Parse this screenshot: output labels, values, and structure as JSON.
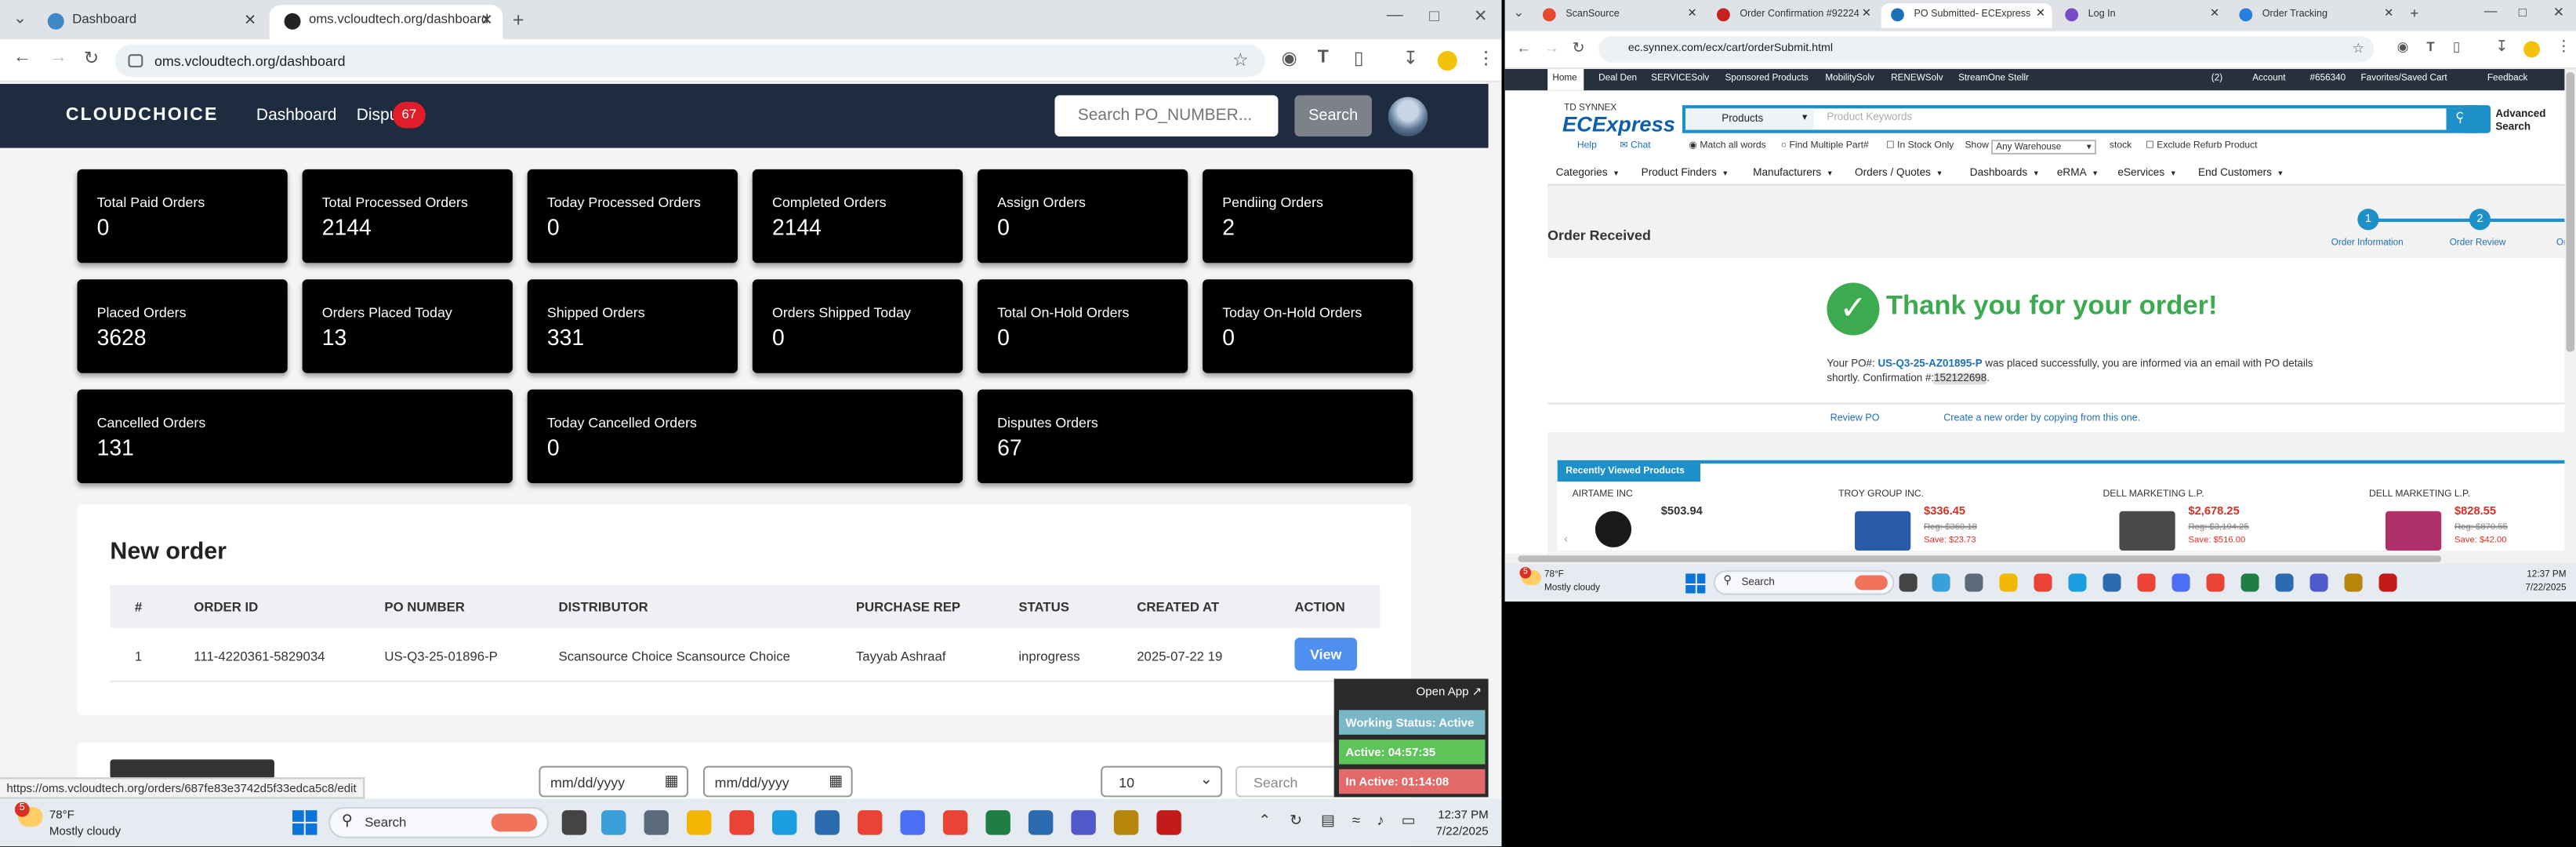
{
  "left_browser": {
    "tabs": [
      {
        "title": "Dashboard"
      },
      {
        "title": "oms.vcloudtech.org/dashboard"
      }
    ],
    "url": "oms.vcloudtech.org/dashboard"
  },
  "oms": {
    "logo": "CLOUDCHOICE",
    "nav": {
      "dashboard": "Dashboard",
      "disputes": "Dispu",
      "disputes_badge": "67"
    },
    "search": {
      "placeholder": "Search PO_NUMBER...",
      "button": "Search"
    },
    "stats": [
      {
        "label": "Total Paid Orders",
        "value": "0"
      },
      {
        "label": "Total Processed Orders",
        "value": "2144"
      },
      {
        "label": "Today Processed Orders",
        "value": "0"
      },
      {
        "label": "Completed Orders",
        "value": "2144"
      },
      {
        "label": "Assign Orders",
        "value": "0"
      },
      {
        "label": "Pendiing Orders",
        "value": "2"
      },
      {
        "label": "Placed Orders",
        "value": "3628"
      },
      {
        "label": "Orders Placed Today",
        "value": "13"
      },
      {
        "label": "Shipped Orders",
        "value": "331"
      },
      {
        "label": "Orders Shipped Today",
        "value": "0"
      },
      {
        "label": "Total On-Hold Orders",
        "value": "0"
      },
      {
        "label": "Today On-Hold Orders",
        "value": "0"
      },
      {
        "label": "Cancelled Orders",
        "value": "131"
      },
      {
        "label": "Today Cancelled Orders",
        "value": "0"
      },
      {
        "label": "Disputes Orders",
        "value": "67"
      }
    ],
    "new_order": {
      "title": "New order",
      "columns": [
        "#",
        "ORDER ID",
        "PO NUMBER",
        "DISTRIBUTOR",
        "PURCHASE REP",
        "STATUS",
        "CREATED AT",
        "ACTION"
      ],
      "rows": [
        {
          "num": "1",
          "order_id": "111-4220361-5829034",
          "po": "US-Q3-25-01896-P",
          "distributor": "Scansource Choice Scansource Choice",
          "rep": "Tayyab Ashraaf",
          "status": "inprogress",
          "created": "2025-07-22 19",
          "action": "View"
        }
      ]
    },
    "bottom": {
      "date1": "mm/dd/yyyy",
      "date2": "mm/dd/yyyy",
      "page_size": "10",
      "search": "Search"
    },
    "status_link": "https://oms.vcloudtech.org/orders/687fe83e3742d5f33edca5c8/edit",
    "work_widget": {
      "open_app": "Open App ↗",
      "status": "Working Status: Active",
      "active": "Active: 04:57:35",
      "inactive": "In Active: 01:14:08"
    }
  },
  "left_taskbar": {
    "weather_temp": "78°F",
    "weather_desc": "Mostly cloudy",
    "weather_badge": "5",
    "search": "Search",
    "time": "12:37 PM",
    "date": "7/22/2025"
  },
  "right_browser": {
    "tabs": [
      {
        "title": "ScanSource"
      },
      {
        "title": "Order Confirmation #92224"
      },
      {
        "title": "PO Submitted- ECExpress"
      },
      {
        "title": "Log In"
      },
      {
        "title": "Order Tracking"
      }
    ],
    "url": "ec.synnex.com/ecx/cart/orderSubmit.html",
    "top_nav": [
      "Home",
      "Deal Den",
      "SERVICESolv",
      "Sponsored Products",
      "MobilitySolv",
      "RENEWSolv",
      "StreamOne Stellr"
    ],
    "top_right": {
      "msgs": "(2)",
      "account": "Account",
      "acct_no": "#656340",
      "favorites": "Favorites/Saved Cart",
      "feedback": "Feedback"
    },
    "brand_small": "TD SYNNEX",
    "brand": "ECExpress",
    "search_select": "Products",
    "search_placeholder": "Product Keywords",
    "adv_search": [
      "Advanced",
      "Search"
    ],
    "help": "Help",
    "chat": "Chat",
    "options": {
      "match": "Match all words",
      "multi": "Find Multiple Part#",
      "instock": "In Stock Only",
      "show": "Show",
      "warehouse": "Any Warehouse",
      "stock": "stock",
      "exclude": "Exclude Refurb Product"
    },
    "categories": [
      "Categories",
      "Product Finders",
      "Manufacturers",
      "Orders / Quotes",
      "Dashboards",
      "eRMA",
      "eServices",
      "End Customers"
    ],
    "order_received": "Order Received",
    "steps": [
      {
        "n": "1",
        "label": "Order Information"
      },
      {
        "n": "2",
        "label": "Order Review"
      },
      {
        "label": "Or"
      }
    ],
    "thank_you": "Thank you for your order!",
    "msg": {
      "pre": "Your PO#: ",
      "po": "US-Q3-25-AZ01895-P",
      "mid": " was placed successfully, you are informed via an email with PO details shortly. Confirmation #:",
      "conf": "152122698",
      "end": "."
    },
    "links": {
      "review": "Review PO",
      "create": "Create a new order by copying from this one."
    },
    "recent_title": "Recently Viewed Products",
    "recent": [
      {
        "vendor": "AIRTAME INC",
        "price": "$503.94"
      },
      {
        "vendor": "TROY GROUP INC.",
        "price": "$336.45",
        "reg": "Reg: $360.18",
        "save": "Save: $23.73"
      },
      {
        "vendor": "DELL MARKETING L.P.",
        "price": "$2,678.25",
        "reg": "Reg: $3,194.25",
        "save": "Save: $516.00"
      },
      {
        "vendor": "DELL MARKETING L.P.",
        "price": "$828.55",
        "reg": "Reg: $870.55",
        "save": "Save: $42.00"
      }
    ]
  },
  "right_taskbar": {
    "weather_temp": "78°F",
    "weather_desc": "Mostly cloudy",
    "weather_badge": "5",
    "search": "Search",
    "time": "12:37 PM",
    "date": "7/22/2025"
  }
}
